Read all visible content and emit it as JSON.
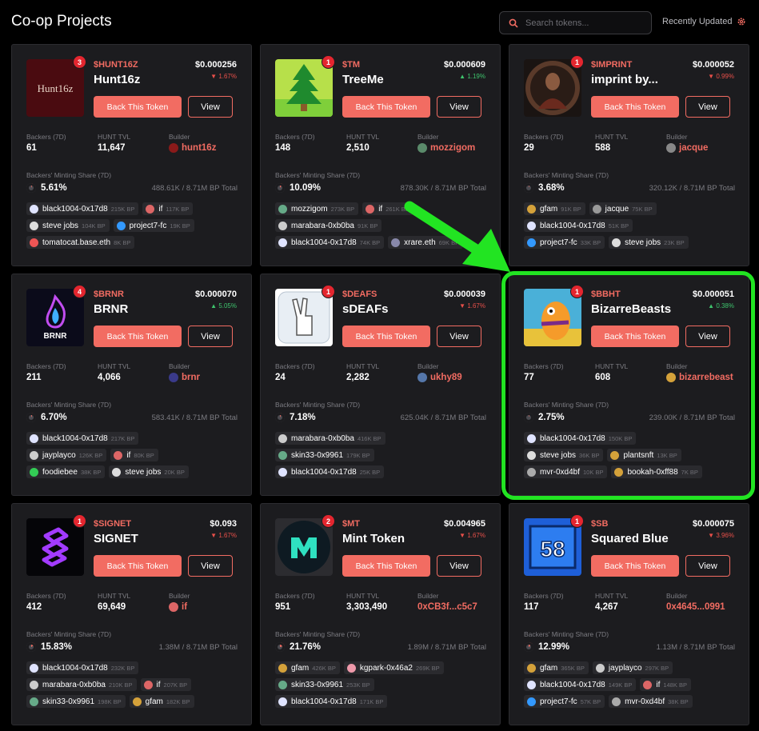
{
  "header": {
    "title": "Co-op Projects",
    "search_placeholder": "Search tokens...",
    "sort_label": "Recently Updated"
  },
  "labels": {
    "back_button": "Back This Token",
    "view_button": "View",
    "backers": "Backers (7D)",
    "tvl": "HUNT TVL",
    "builder": "Builder",
    "share": "Backers' Minting Share (7D)"
  },
  "colors": {
    "accent": "#f26c62",
    "down": "#e8504a",
    "up": "#3ec46d",
    "highlight": "#22e422",
    "badge": "#e4262f"
  },
  "cards": [
    {
      "rank": "3",
      "ticker": "$HUNT16Z",
      "name": "Hunt16z",
      "price": "$0.000256",
      "change": "▼ 1.67%",
      "dir": "down",
      "backers": "61",
      "tvl": "11,647",
      "builder": "hunt16z",
      "share_pct": "5.61%",
      "share_total": "488.61K / 8.71M BP Total",
      "share_frac": 0.056,
      "chips": [
        [
          {
            "n": "black1004-0x17d8",
            "bp": "215K BP",
            "c": "#dfe3ff"
          },
          {
            "n": "if",
            "bp": "117K BP",
            "c": "#d66"
          }
        ],
        [
          {
            "n": "steve jobs",
            "bp": "104K BP",
            "c": "#ddd"
          },
          {
            "n": "project7-fc",
            "bp": "19K BP",
            "c": "#39f"
          }
        ],
        [
          {
            "n": "tomatocat.base.eth",
            "bp": "8K BP",
            "c": "#e55"
          }
        ]
      ]
    },
    {
      "rank": "1",
      "ticker": "$TM",
      "name": "TreeMe",
      "price": "$0.000609",
      "change": "▲ 1.19%",
      "dir": "up",
      "backers": "148",
      "tvl": "2,510",
      "builder": "mozzigom",
      "share_pct": "10.09%",
      "share_total": "878.30K / 8.71M BP Total",
      "share_frac": 0.101,
      "chips": [
        [
          {
            "n": "mozzigom",
            "bp": "273K BP",
            "c": "#6a8"
          },
          {
            "n": "if",
            "bp": "261K BP",
            "c": "#d66"
          }
        ],
        [
          {
            "n": "marabara-0xb0ba",
            "bp": "91K BP",
            "c": "#ccc"
          }
        ],
        [
          {
            "n": "black1004-0x17d8",
            "bp": "74K BP",
            "c": "#dfe3ff"
          },
          {
            "n": "xrare.eth",
            "bp": "69K BP",
            "c": "#88a"
          }
        ]
      ]
    },
    {
      "rank": "1",
      "ticker": "$IMPRINT",
      "name": "imprint by...",
      "price": "$0.000052",
      "change": "▼ 0.99%",
      "dir": "down",
      "backers": "29",
      "tvl": "588",
      "builder": "jacque",
      "share_pct": "3.68%",
      "share_total": "320.12K / 8.71M BP Total",
      "share_frac": 0.037,
      "chips": [
        [
          {
            "n": "gfam",
            "bp": "91K BP",
            "c": "#d4a13a"
          },
          {
            "n": "jacque",
            "bp": "75K BP",
            "c": "#999"
          }
        ],
        [
          {
            "n": "black1004-0x17d8",
            "bp": "51K BP",
            "c": "#dfe3ff"
          }
        ],
        [
          {
            "n": "project7-fc",
            "bp": "33K BP",
            "c": "#39f"
          },
          {
            "n": "steve jobs",
            "bp": "23K BP",
            "c": "#ddd"
          }
        ]
      ]
    },
    {
      "rank": "4",
      "ticker": "$BRNR",
      "name": "BRNR",
      "price": "$0.000070",
      "change": "▲ 5.05%",
      "dir": "up",
      "backers": "211",
      "tvl": "4,066",
      "builder": "brnr",
      "share_pct": "6.70%",
      "share_total": "583.41K / 8.71M BP Total",
      "share_frac": 0.067,
      "chips": [
        [
          {
            "n": "black1004-0x17d8",
            "bp": "217K BP",
            "c": "#dfe3ff"
          }
        ],
        [
          {
            "n": "jayplayco",
            "bp": "126K BP",
            "c": "#ccc"
          },
          {
            "n": "if",
            "bp": "80K BP",
            "c": "#d66"
          }
        ],
        [
          {
            "n": "foodiebee",
            "bp": "38K BP",
            "c": "#3c5"
          },
          {
            "n": "steve jobs",
            "bp": "20K BP",
            "c": "#ddd"
          }
        ]
      ]
    },
    {
      "rank": "1",
      "ticker": "$DEAFS",
      "name": "sDEAFs",
      "price": "$0.000039",
      "change": "▼ 1.67%",
      "dir": "down",
      "backers": "24",
      "tvl": "2,282",
      "builder": "ukhy89",
      "share_pct": "7.18%",
      "share_total": "625.04K / 8.71M BP Total",
      "share_frac": 0.072,
      "chips": [
        [
          {
            "n": "marabara-0xb0ba",
            "bp": "416K BP",
            "c": "#ccc"
          }
        ],
        [
          {
            "n": "skin33-0x9961",
            "bp": "179K BP",
            "c": "#6a8"
          }
        ],
        [
          {
            "n": "black1004-0x17d8",
            "bp": "25K BP",
            "c": "#dfe3ff"
          }
        ]
      ]
    },
    {
      "rank": "1",
      "ticker": "$BBHT",
      "name": "BizarreBeasts",
      "price": "$0.000051",
      "change": "▲ 0.38%",
      "dir": "up",
      "backers": "77",
      "tvl": "608",
      "builder": "bizarrebeast",
      "share_pct": "2.75%",
      "share_total": "239.00K / 8.71M BP Total",
      "share_frac": 0.028,
      "chips": [
        [
          {
            "n": "black1004-0x17d8",
            "bp": "150K BP",
            "c": "#dfe3ff"
          }
        ],
        [
          {
            "n": "steve jobs",
            "bp": "36K BP",
            "c": "#ddd"
          },
          {
            "n": "plantsnft",
            "bp": "13K BP",
            "c": "#d4a13a"
          }
        ],
        [
          {
            "n": "mvr-0xd4bf",
            "bp": "10K BP",
            "c": "#aaa"
          },
          {
            "n": "bookah-0xff88",
            "bp": "7K BP",
            "c": "#d4a13a"
          }
        ]
      ]
    },
    {
      "rank": "1",
      "ticker": "$SIGNET",
      "name": "SIGNET",
      "price": "$0.093",
      "change": "▼ 1.67%",
      "dir": "down",
      "backers": "412",
      "tvl": "69,649",
      "builder": "if",
      "share_pct": "15.83%",
      "share_total": "1.38M / 8.71M BP Total",
      "share_frac": 0.158,
      "chips": [
        [
          {
            "n": "black1004-0x17d8",
            "bp": "232K BP",
            "c": "#dfe3ff"
          }
        ],
        [
          {
            "n": "marabara-0xb0ba",
            "bp": "210K BP",
            "c": "#ccc"
          },
          {
            "n": "if",
            "bp": "207K BP",
            "c": "#d66"
          }
        ],
        [
          {
            "n": "skin33-0x9961",
            "bp": "198K BP",
            "c": "#6a8"
          },
          {
            "n": "gfam",
            "bp": "182K BP",
            "c": "#d4a13a"
          }
        ]
      ]
    },
    {
      "rank": "2",
      "ticker": "$MT",
      "name": "Mint Token",
      "price": "$0.004965",
      "change": "▼ 1.67%",
      "dir": "down",
      "backers": "951",
      "tvl": "3,303,490",
      "builder": "0xCB3f...c5c7",
      "share_pct": "21.76%",
      "share_total": "1.89M / 8.71M BP Total",
      "share_frac": 0.218,
      "chips": [
        [
          {
            "n": "gfam",
            "bp": "426K BP",
            "c": "#d4a13a"
          },
          {
            "n": "kgpark-0x46a2",
            "bp": "269K BP",
            "c": "#e9a"
          }
        ],
        [
          {
            "n": "skin33-0x9961",
            "bp": "253K BP",
            "c": "#6a8"
          }
        ],
        [
          {
            "n": "black1004-0x17d8",
            "bp": "171K BP",
            "c": "#dfe3ff"
          }
        ]
      ]
    },
    {
      "rank": "1",
      "ticker": "$SB",
      "name": "Squared Blue",
      "price": "$0.000075",
      "change": "▼ 3.96%",
      "dir": "down",
      "backers": "117",
      "tvl": "4,267",
      "builder": "0x4645...0991",
      "share_pct": "12.99%",
      "share_total": "1.13M / 8.71M BP Total",
      "share_frac": 0.13,
      "chips": [
        [
          {
            "n": "gfam",
            "bp": "365K BP",
            "c": "#d4a13a"
          },
          {
            "n": "jayplayco",
            "bp": "297K BP",
            "c": "#ccc"
          }
        ],
        [
          {
            "n": "black1004-0x17d8",
            "bp": "149K BP",
            "c": "#dfe3ff"
          },
          {
            "n": "if",
            "bp": "148K BP",
            "c": "#d66"
          }
        ],
        [
          {
            "n": "project7-fc",
            "bp": "57K BP",
            "c": "#39f"
          },
          {
            "n": "mvr-0xd4bf",
            "bp": "38K BP",
            "c": "#aaa"
          }
        ]
      ]
    }
  ]
}
